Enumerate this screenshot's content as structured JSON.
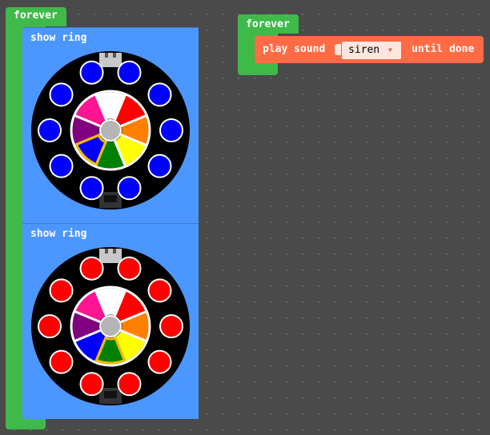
{
  "blocks": {
    "left_forever": {
      "label": "forever"
    },
    "right_forever": {
      "label": "forever"
    },
    "show_ring_1": {
      "label": "show ring",
      "outer_led_color": "#0000ff",
      "selected_color": "blue"
    },
    "show_ring_2": {
      "label": "show ring",
      "outer_led_color": "#ff0000",
      "selected_color": "green"
    },
    "play_sound": {
      "label_before": "play sound",
      "selected_sound": "siren",
      "label_after": "until done"
    }
  },
  "colors": {
    "palette": [
      "#ffffff",
      "#ff0000",
      "#ff8000",
      "#ffff00",
      "#008000",
      "#0000ff",
      "#800080",
      "#ff1493"
    ],
    "block_green": "#3fba4a",
    "block_blue": "#4b97ff",
    "block_orange": "#ff6b45"
  }
}
